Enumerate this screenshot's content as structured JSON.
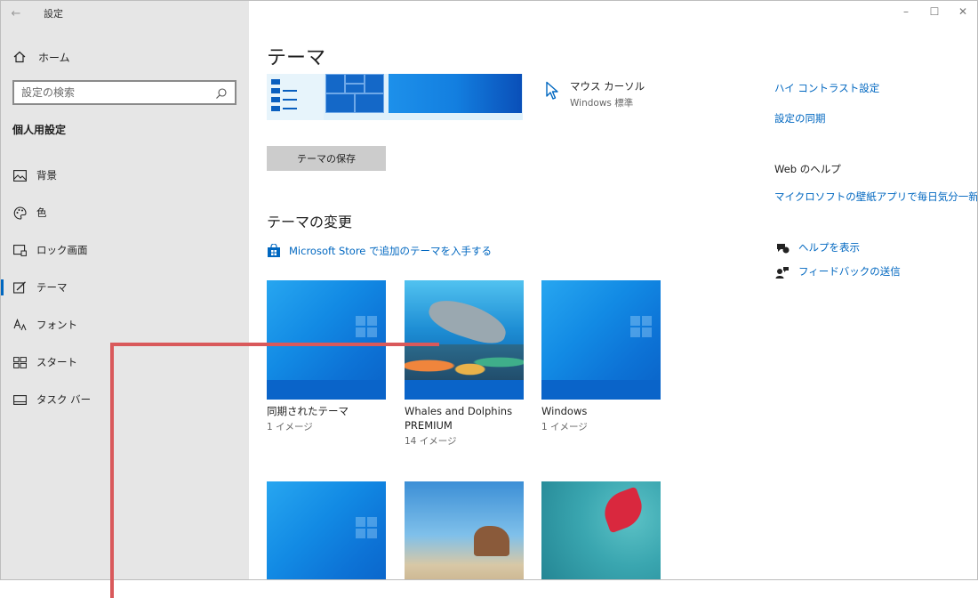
{
  "app": {
    "title": "設定"
  },
  "window_controls": {
    "minimize": "–",
    "maximize": "☐",
    "close": "✕"
  },
  "sidebar": {
    "home_label": "ホーム",
    "search_placeholder": "設定の検索",
    "section_title": "個人用設定",
    "items": [
      {
        "label": "背景",
        "icon": "image-icon"
      },
      {
        "label": "色",
        "icon": "palette-icon"
      },
      {
        "label": "ロック画面",
        "icon": "lock-screen-icon"
      },
      {
        "label": "テーマ",
        "icon": "theme-brush-icon",
        "active": true
      },
      {
        "label": "フォント",
        "icon": "font-icon"
      },
      {
        "label": "スタート",
        "icon": "start-icon"
      },
      {
        "label": "タスク バー",
        "icon": "taskbar-icon"
      }
    ]
  },
  "main": {
    "title": "テーマ",
    "cursor": {
      "title": "マウス カーソル",
      "value": "Windows 標準"
    },
    "save_button": "テーマの保存",
    "change_title": "テーマの変更",
    "store_link": "Microsoft Store で追加のテーマを入手する",
    "themes": [
      {
        "name": "同期されたテーマ",
        "count": "1 イメージ"
      },
      {
        "name": "Whales and Dolphins PREMIUM",
        "count": "14 イメージ"
      },
      {
        "name": "Windows",
        "count": "1 イメージ"
      }
    ]
  },
  "related": {
    "high_contrast": "ハイ コントラスト設定",
    "sync": "設定の同期",
    "web_help_title": "Web のヘルプ",
    "wallpaper_app": "マイクロソフトの壁紙アプリで毎日気分一新",
    "get_help": "ヘルプを表示",
    "feedback": "フィードバックの送信"
  },
  "colors": {
    "accent": "#0067c0",
    "annotation": "#d9595b",
    "sidebar_bg": "#e6e6e6"
  }
}
